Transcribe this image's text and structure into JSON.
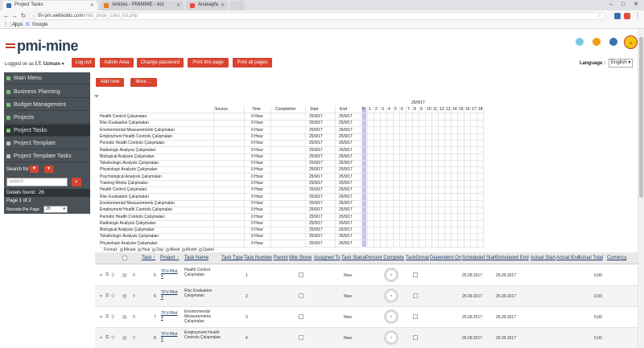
{
  "browser": {
    "tabs": [
      {
        "label": "Project Tasks",
        "active": true,
        "color": "#3b6fb6"
      },
      {
        "label": "Articles - PMIMINE - Act",
        "active": false,
        "color": "#e67e22"
      },
      {
        "label": "Anasayfa",
        "active": false,
        "color": "#e74c3c"
      }
    ],
    "url_host": "tfv-pm.webkobis.com",
    "url_path": "/mkb_proje_isleri_list.php",
    "bookmarks": [
      "Apps",
      "Google"
    ]
  },
  "header": {
    "logo_text": "pmi-mine",
    "logged_label": "Logged on as",
    "user_name": "İ.T. Uzmanı",
    "buttons": [
      "Log out",
      "Admin Area",
      "Change password",
      "Print this page",
      "Print all pages"
    ],
    "language_label": "Language :",
    "language_value": "English",
    "accent": "#d9432f"
  },
  "sidebar": {
    "items": [
      {
        "label": "Main Menu",
        "active": false
      },
      {
        "label": "Business Planning",
        "active": false
      },
      {
        "label": "Budget Management",
        "active": false
      },
      {
        "label": "Projects",
        "active": false
      },
      {
        "label": "Project Tasks",
        "active": true
      },
      {
        "label": "Project Template",
        "active": false
      },
      {
        "label": "Project Template Tasks",
        "active": false
      }
    ],
    "search_for": "Search for",
    "search_placeholder": "search",
    "details_found": "Details found : 26",
    "page_info": "Page 1 of 2",
    "records_label": "Records Per Page",
    "records_value": "20"
  },
  "main": {
    "add_new": "Add new",
    "more": "More ...",
    "gantt": {
      "date_header": "25/9/17",
      "columns": [
        "Source",
        "Time",
        "Completion",
        "Start",
        "End"
      ],
      "hours": [
        "0",
        "1",
        "2",
        "3",
        "4",
        "5",
        "6",
        "7",
        "8",
        "9",
        "10",
        "11",
        "12",
        "13",
        "14",
        "15",
        "16",
        "17",
        "18"
      ],
      "rows": [
        "Health Control Çalışmaları",
        "Risc Evaluation Çalışmaları",
        "Environmental Measurements Çalışmaları",
        "Employment Health Controls Çalışmaları",
        "Periodic Health Controls Çalışmaları",
        "Radiologic Analysis Çalışmaları",
        "Biological Analysis Çalışmaları",
        "Toksikologic Analysis Çalışmaları",
        "Physiologic Analysis Çalışmaları",
        "Psychological Analysis Çalışmaları",
        "Training Works Çalışmaları",
        "Health Control Çalışmaları",
        "Risc Evaluation Çalışmaları",
        "Environmental Measurements Çalışmaları",
        "Employment Health Controls Çalışmaları",
        "Periodic Health Controls Çalışmaları",
        "Radiologic Analysis Çalışmaları",
        "Biological Analysis Çalışmaları",
        "Toksikologic Analysis Çalışmaları",
        "Physiologic Analysis Çalışmaları"
      ],
      "time_value": "0 Hour",
      "date_value": "25/9/17",
      "format_label": "Format:",
      "format_options": [
        "Minute",
        "Hour",
        "Day",
        "Week",
        "Month",
        "Qarter"
      ]
    },
    "grid": {
      "headers": [
        "Task",
        "Project",
        "Task Name",
        "Task Type",
        "Task Number",
        "Parent",
        "Mile Stone",
        "Assigned To",
        "Task Status",
        "Percent Complete",
        "TaskGroup",
        "Dependent On",
        "Scheduled Start",
        "Scheduled End",
        "Actual Start",
        "Actual End",
        "Actual Total",
        "Currency"
      ],
      "rows": [
        {
          "id": "5",
          "project": "TFV-Pilot 4",
          "name": "Health Control Çalışmaları",
          "number": "1",
          "status": "New",
          "sched_start": "25.09.2017",
          "sched_end": "25.09.2017",
          "total": "0,00"
        },
        {
          "id": "6",
          "project": "TFV-Pilot 4",
          "name": "Risc Evaluation Çalışmaları",
          "number": "2",
          "status": "New",
          "sched_start": "25.09.2017",
          "sched_end": "25.09.2017",
          "total": "0,00"
        },
        {
          "id": "7",
          "project": "TFV-Pilot 4",
          "name": "Environmental Measurements Çalışmaları",
          "number": "3",
          "status": "New",
          "sched_start": "25.09.2017",
          "sched_end": "25.09.2017",
          "total": "0,00"
        },
        {
          "id": "8",
          "project": "TFV-Pilot 4",
          "name": "Employment Health Controls Çalışmaları",
          "number": "4",
          "status": "New",
          "sched_start": "25.09.2017",
          "sched_end": "25.09.2017",
          "total": "0,00"
        }
      ]
    }
  }
}
